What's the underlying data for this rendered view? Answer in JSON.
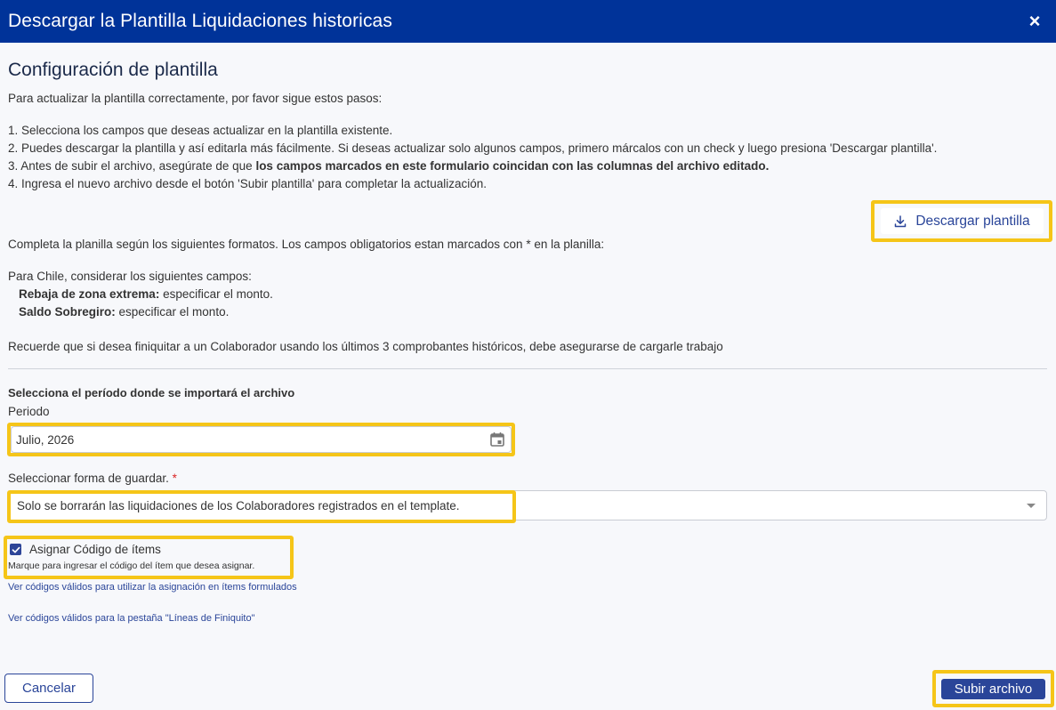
{
  "header": {
    "title": "Descargar la Plantilla Liquidaciones historicas",
    "close_icon": "×"
  },
  "main": {
    "section_title": "Configuración de plantilla",
    "intro": "Para actualizar la plantilla correctamente, por favor sigue estos pasos:",
    "steps": {
      "s1": "1. Selecciona los campos que deseas actualizar en la plantilla existente.",
      "s2": "2. Puedes descargar la plantilla y así editarla más fácilmente. Si deseas actualizar solo algunos campos, primero márcalos con un check y luego presiona 'Descargar plantilla'.",
      "s3_prefix": "3. Antes de subir el archivo, asegúrate de que ",
      "s3_bold": "los campos marcados en este formulario coincidan con las columnas del archivo editado.",
      "s4": "4. Ingresa el nuevo archivo desde el botón 'Subir plantilla' para completar la actualización."
    },
    "download_button_label": "Descargar plantilla",
    "format_note": "Completa la planilla según los siguientes formatos. Los campos obligatorios estan marcados con * en la planilla:",
    "chile_intro": "Para Chile, considerar los siguientes campos:",
    "chile_fields": {
      "f1_name": "Rebaja de zona extrema:",
      "f1_desc": " especificar el monto.",
      "f2_name": "Saldo Sobregiro:",
      "f2_desc": " especificar el monto."
    },
    "reminder": "Recuerde que si desea finiquitar a un Colaborador usando los últimos 3 comprobantes históricos, debe asegurarse de cargarle trabajo",
    "period_section_title": "Selecciona el período donde se importará el archivo",
    "period_label": "Periodo",
    "period_value": "Julio, 2026",
    "save_mode_label": "Seleccionar forma de guardar.",
    "save_mode_required": "*",
    "save_mode_value": "Solo se borrarán las liquidaciones de los Colaboradores registrados en el template.",
    "assign_checkbox_label": "Asignar Código de ítems",
    "assign_checkbox_checked": true,
    "assign_help": "Marque para ingresar el código del ítem que desea asignar.",
    "link_formulated": "Ver códigos válidos para utilizar la asignación en ítems formulados",
    "link_finiquito": "Ver códigos válidos para la pestaña \"Líneas de Finiquito\""
  },
  "footer": {
    "cancel_label": "Cancelar",
    "submit_label": "Subir archivo"
  },
  "colors": {
    "header_bg": "#003399",
    "primary": "#2a4599",
    "highlight": "#f5c518",
    "required": "#d92626"
  }
}
